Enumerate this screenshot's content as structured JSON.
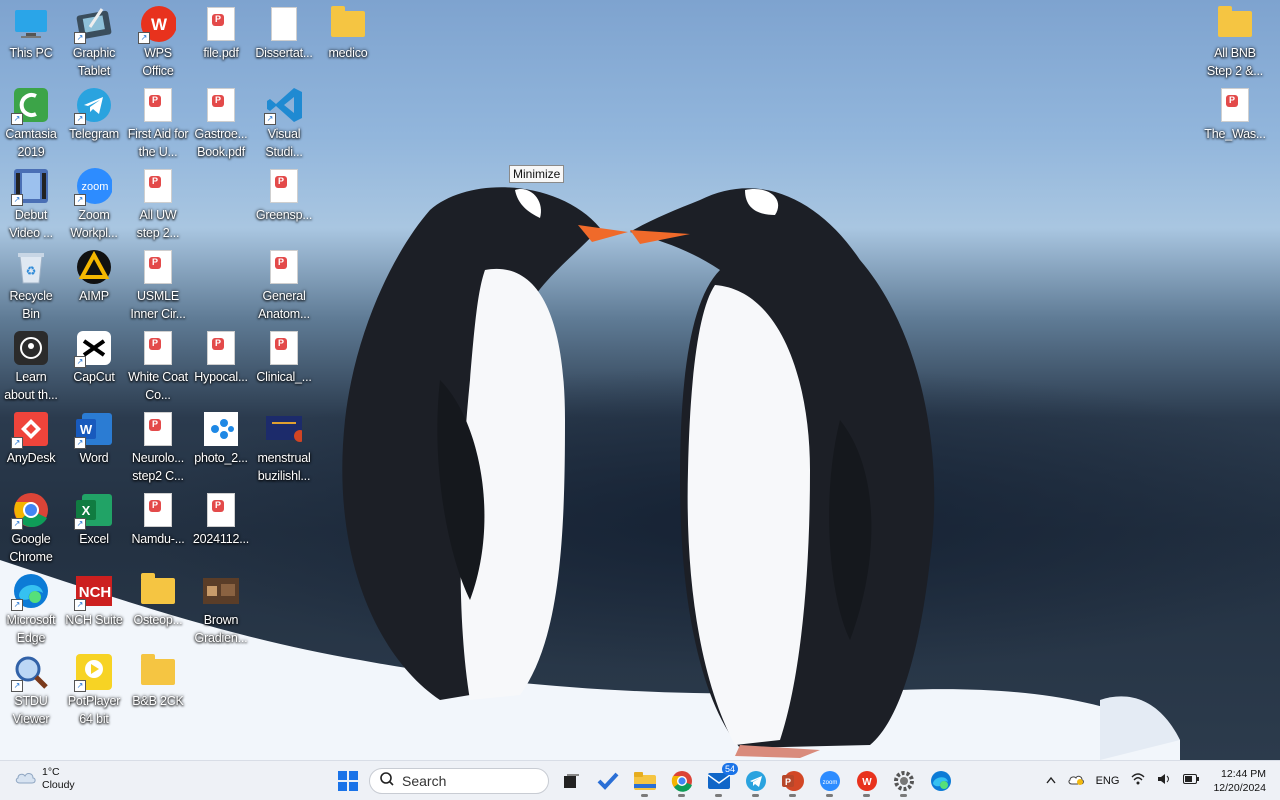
{
  "desktop": {
    "tooltip": "Minimize",
    "icons": [
      {
        "key": "this-pc",
        "label": "This PC"
      },
      {
        "key": "graphic-tablet",
        "label": "Graphic Tablet"
      },
      {
        "key": "wps-office",
        "label": "WPS Office"
      },
      {
        "key": "file-pdf",
        "label": "file.pdf"
      },
      {
        "key": "dissertat",
        "label": "Dissertat..."
      },
      {
        "key": "medico",
        "label": "medico"
      },
      {
        "key": "camtasia",
        "label": "Camtasia 2019"
      },
      {
        "key": "telegram",
        "label": "Telegram"
      },
      {
        "key": "first-aid",
        "label": "First Aid for the U..."
      },
      {
        "key": "gastroe",
        "label": "Gastroe... Book.pdf"
      },
      {
        "key": "visual-studio",
        "label": "Visual Studi..."
      },
      {
        "key": "debut-video",
        "label": "Debut Video ..."
      },
      {
        "key": "zoom",
        "label": "Zoom Workpl..."
      },
      {
        "key": "all-uw",
        "label": "All UW step 2..."
      },
      {
        "key": "greensp",
        "label": "Greensp..."
      },
      {
        "key": "recycle-bin",
        "label": "Recycle Bin"
      },
      {
        "key": "aimp",
        "label": "AIMP"
      },
      {
        "key": "usmle",
        "label": "USMLE Inner Cir..."
      },
      {
        "key": "general-anatom",
        "label": "General Anatom..."
      },
      {
        "key": "learn",
        "label": "Learn about th..."
      },
      {
        "key": "capcut",
        "label": "CapCut"
      },
      {
        "key": "white-coat",
        "label": "White Coat Co..."
      },
      {
        "key": "hypocal",
        "label": "Hypocal..."
      },
      {
        "key": "clinical",
        "label": "Clinical_..."
      },
      {
        "key": "anydesk",
        "label": "AnyDesk"
      },
      {
        "key": "word",
        "label": "Word"
      },
      {
        "key": "neurolo",
        "label": "Neurolo... step2 C..."
      },
      {
        "key": "photo",
        "label": "photo_2..."
      },
      {
        "key": "menstrual",
        "label": "menstrual buzilishl..."
      },
      {
        "key": "google-chrome",
        "label": "Google Chrome"
      },
      {
        "key": "excel",
        "label": "Excel"
      },
      {
        "key": "namdu",
        "label": "Namdu-..."
      },
      {
        "key": "file-2024",
        "label": "2024112..."
      },
      {
        "key": "microsoft-edge",
        "label": "Microsoft Edge"
      },
      {
        "key": "nch-suite",
        "label": "NCH Suite"
      },
      {
        "key": "osteop",
        "label": "Osteop..."
      },
      {
        "key": "brown-gradien",
        "label": "Brown Gradien..."
      },
      {
        "key": "stdu-viewer",
        "label": "STDU Viewer"
      },
      {
        "key": "potplayer",
        "label": "PotPlayer 64 bit"
      },
      {
        "key": "bb-2ck",
        "label": "B&B 2CK"
      },
      {
        "key": "all-bnb",
        "label": "All BNB Step 2 &..."
      },
      {
        "key": "the-was",
        "label": "The_Was..."
      }
    ]
  },
  "taskbar": {
    "weather_temp": "1°C",
    "weather_desc": "Cloudy",
    "search_label": "Search",
    "outlook_badge": "54",
    "language": "ENG",
    "time": "12:44 PM",
    "date": "12/20/2024"
  },
  "colors": {
    "taskbar_bg": "#eef1f6",
    "accent": "#1a73e8"
  }
}
